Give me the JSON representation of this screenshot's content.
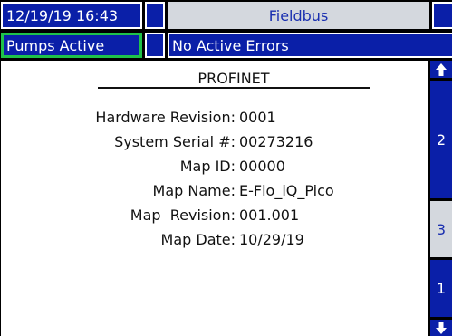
{
  "header": {
    "datetime": "12/19/19 16:43",
    "screen_title": "Fieldbus"
  },
  "status": {
    "pumps": "Pumps Active",
    "errors": "No Active Errors"
  },
  "panel": {
    "title": "PROFINET",
    "rows": [
      {
        "label": "Hardware Revision:",
        "value": "0001"
      },
      {
        "label": "System Serial #:",
        "value": "00273216"
      },
      {
        "label": "Map ID:",
        "value": "00000"
      },
      {
        "label": "Map Name:",
        "value": "E-Flo_iQ_Pico"
      },
      {
        "label": "Map  Revision:",
        "value": "001.001"
      },
      {
        "label": "Map Date:",
        "value": "10/29/19"
      }
    ]
  },
  "sidebar": {
    "up_icon": "arrow-up-icon",
    "page_2": "2",
    "page_3": "3",
    "page_1": "1",
    "down_icon": "arrow-down-icon"
  },
  "colors": {
    "blue": "#0a1fa8",
    "light_gray": "#d4d8de",
    "active_green": "#1fc24a"
  }
}
